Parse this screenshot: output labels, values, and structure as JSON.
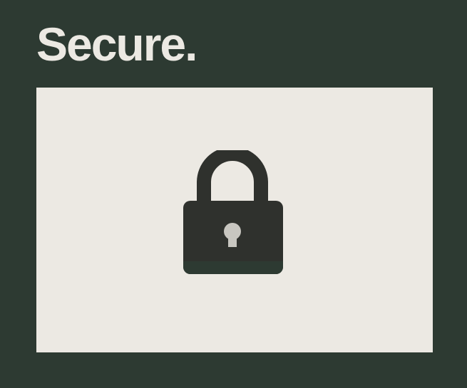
{
  "headline": "Secure.",
  "illustration": {
    "icon": "padlock-icon",
    "colors": {
      "background": "#2d3a32",
      "panel": "#ece9e3",
      "lock_body": "#2f312d",
      "lock_base_stripe": "#2d3a32",
      "keyhole": "#c8c6c0"
    }
  }
}
